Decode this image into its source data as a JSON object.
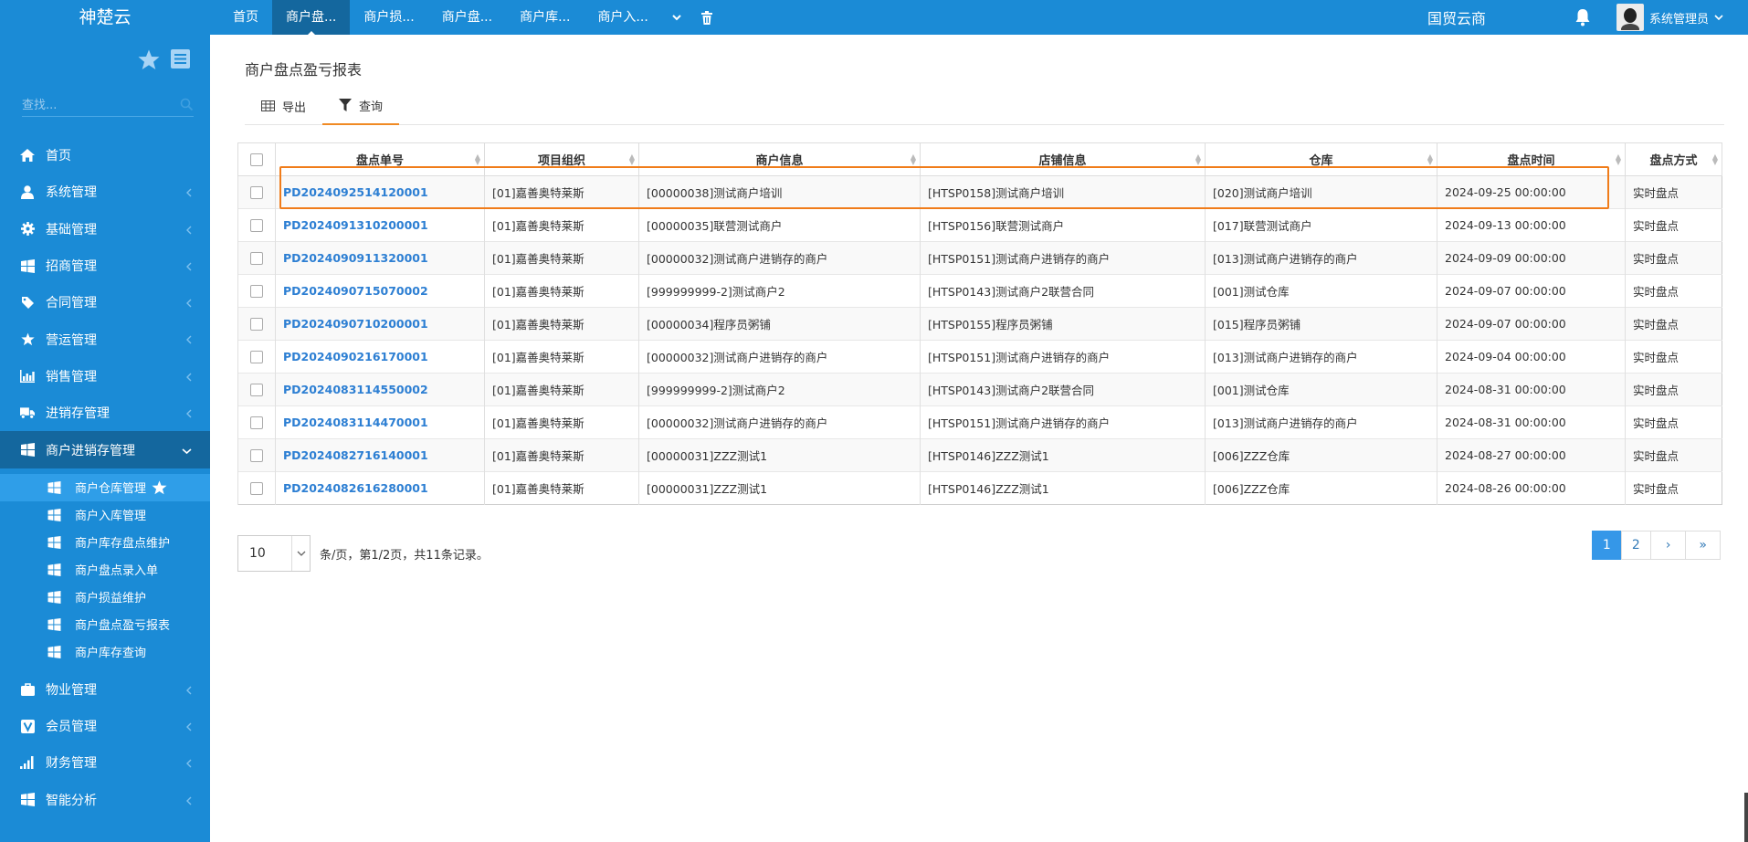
{
  "app": {
    "brand": "神楚云",
    "org": "国贸云商",
    "user": "系统管理员"
  },
  "topnav": {
    "tabs": [
      {
        "label": "首页"
      },
      {
        "label": "商户盘..."
      },
      {
        "label": "商户损..."
      },
      {
        "label": "商户盘..."
      },
      {
        "label": "商户库..."
      },
      {
        "label": "商户入..."
      }
    ]
  },
  "sidebar": {
    "search_placeholder": "查找...",
    "menu": [
      {
        "label": "首页",
        "icon": "home-icon"
      },
      {
        "label": "系统管理",
        "icon": "user-icon"
      },
      {
        "label": "基础管理",
        "icon": "gear-icon"
      },
      {
        "label": "招商管理",
        "icon": "windows-icon"
      },
      {
        "label": "合同管理",
        "icon": "tag-icon"
      },
      {
        "label": "营运管理",
        "icon": "star-icon"
      },
      {
        "label": "销售管理",
        "icon": "bar-chart-icon"
      },
      {
        "label": "进销存管理",
        "icon": "truck-icon"
      },
      {
        "label": "商户进销存管理",
        "icon": "windows-icon"
      }
    ],
    "submenu": [
      {
        "label": "商户仓库管理"
      },
      {
        "label": "商户入库管理"
      },
      {
        "label": "商户库存盘点维护"
      },
      {
        "label": "商户盘点录入单"
      },
      {
        "label": "商户损益维护"
      },
      {
        "label": "商户盘点盈亏报表"
      },
      {
        "label": "商户库存查询"
      }
    ],
    "menu_after": [
      {
        "label": "物业管理",
        "icon": "briefcase-icon"
      },
      {
        "label": "会员管理",
        "icon": "vip-icon"
      },
      {
        "label": "财务管理",
        "icon": "signal-icon"
      },
      {
        "label": "智能分析",
        "icon": "windows-icon"
      }
    ]
  },
  "page": {
    "title": "商户盘点盈亏报表",
    "toolbar": {
      "export_label": "导出",
      "query_label": "查询"
    }
  },
  "table": {
    "columns": [
      "盘点单号",
      "项目组织",
      "商户信息",
      "店铺信息",
      "仓库",
      "盘点时间",
      "盘点方式"
    ],
    "rows": [
      [
        "PD2024092514120001",
        "[01]嘉善奥特莱斯",
        "[00000038]测试商户培训",
        "[HTSP0158]测试商户培训",
        "[020]测试商户培训",
        "2024-09-25 00:00:00",
        "实时盘点"
      ],
      [
        "PD2024091310200001",
        "[01]嘉善奥特莱斯",
        "[00000035]联营测试商户",
        "[HTSP0156]联营测试商户",
        "[017]联营测试商户",
        "2024-09-13 00:00:00",
        "实时盘点"
      ],
      [
        "PD2024090911320001",
        "[01]嘉善奥特莱斯",
        "[00000032]测试商户进销存的商户",
        "[HTSP0151]测试商户进销存的商户",
        "[013]测试商户进销存的商户",
        "2024-09-09 00:00:00",
        "实时盘点"
      ],
      [
        "PD2024090715070002",
        "[01]嘉善奥特莱斯",
        "[999999999-2]测试商户2",
        "[HTSP0143]测试商户2联营合同",
        "[001]测试仓库",
        "2024-09-07 00:00:00",
        "实时盘点"
      ],
      [
        "PD2024090710200001",
        "[01]嘉善奥特莱斯",
        "[00000034]程序员粥铺",
        "[HTSP0155]程序员粥铺",
        "[015]程序员粥铺",
        "2024-09-07 00:00:00",
        "实时盘点"
      ],
      [
        "PD2024090216170001",
        "[01]嘉善奥特莱斯",
        "[00000032]测试商户进销存的商户",
        "[HTSP0151]测试商户进销存的商户",
        "[013]测试商户进销存的商户",
        "2024-09-04 00:00:00",
        "实时盘点"
      ],
      [
        "PD2024083114550002",
        "[01]嘉善奥特莱斯",
        "[999999999-2]测试商户2",
        "[HTSP0143]测试商户2联营合同",
        "[001]测试仓库",
        "2024-08-31 00:00:00",
        "实时盘点"
      ],
      [
        "PD2024083114470001",
        "[01]嘉善奥特莱斯",
        "[00000032]测试商户进销存的商户",
        "[HTSP0151]测试商户进销存的商户",
        "[013]测试商户进销存的商户",
        "2024-08-31 00:00:00",
        "实时盘点"
      ],
      [
        "PD2024082716140001",
        "[01]嘉善奥特莱斯",
        "[00000031]ZZZ测试1",
        "[HTSP0146]ZZZ测试1",
        "[006]ZZZ仓库",
        "2024-08-27 00:00:00",
        "实时盘点"
      ],
      [
        "PD2024082616280001",
        "[01]嘉善奥特莱斯",
        "[00000031]ZZZ测试1",
        "[HTSP0146]ZZZ测试1",
        "[006]ZZZ仓库",
        "2024-08-26 00:00:00",
        "实时盘点"
      ]
    ]
  },
  "pagination": {
    "page_size": "10",
    "info": "条/页，第1/2页，共11条记录。",
    "pages": [
      "1",
      "2"
    ],
    "current": "1",
    "next": "›",
    "last": "»"
  },
  "colors": {
    "brand_blue": "#1b8bd6",
    "dark_blue": "#14679e",
    "highlight_orange": "#f07c1a",
    "link_blue": "#2d7fd3"
  }
}
